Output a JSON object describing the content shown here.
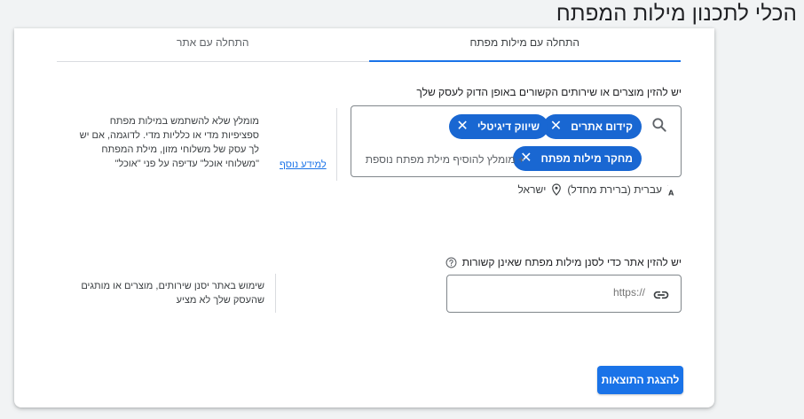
{
  "page": {
    "title": "הכלי לתכנון מילות המפתח"
  },
  "tabs": [
    {
      "label": "התחלה עם אתר"
    },
    {
      "label": "התחלה עם מילות מפתח"
    }
  ],
  "keywords_section": {
    "prompt": "יש להזין מוצרים או שירותים הקשורים באופן הדוק לעסק שלך",
    "chips": [
      "קידום אתרים",
      "שיווק דיגיטלי",
      "מחקר מילות מפתח"
    ],
    "add_hint": "+ מומלץ להוסיף מילת מפתח נוספת",
    "tip": "מומלץ שלא להשתמש במילות מפתח ספציפיות מדי או כלליות מדי. לדוגמה, אם יש לך עסק של משלוחי מזון, מילת המפתח \"משלוחי אוכל\" עדיפה על פני \"אוכל\"",
    "learn_more": "למידע נוסף",
    "language": "עברית (ברירת מחדל)",
    "location": "ישראל"
  },
  "site_section": {
    "prompt": "יש להזין אתר כדי לסנן מילות מפתח שאינן קשורות",
    "placeholder": "https://",
    "tip": "שימוש באתר יסנן שירותים, מוצרים או מותגים שהעסק שלך לא מציע"
  },
  "actions": {
    "show_results": "להצגת התוצאות"
  },
  "colors": {
    "accent": "#1a73e8",
    "chip": "#1967d2"
  }
}
